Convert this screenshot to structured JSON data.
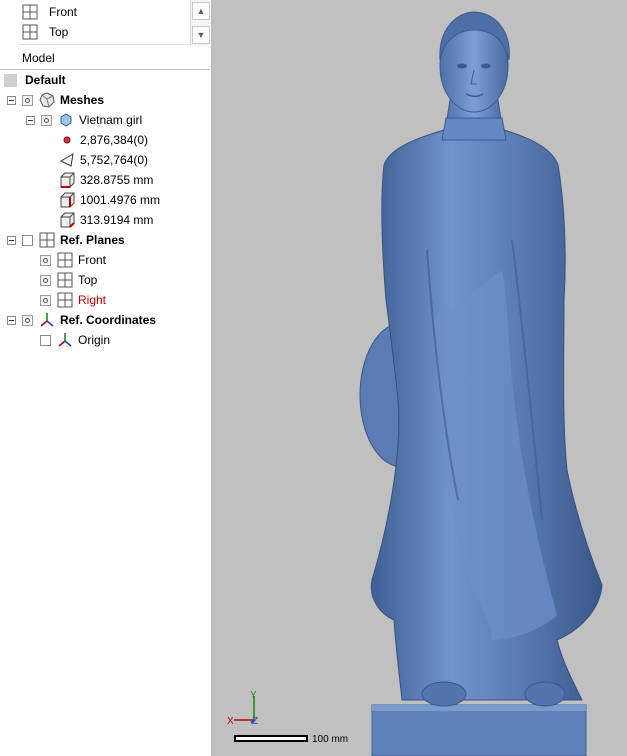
{
  "views": {
    "items": [
      {
        "label": "Front"
      },
      {
        "label": "Top"
      }
    ]
  },
  "model_section": {
    "label": "Model"
  },
  "tree": {
    "root": {
      "label": "Default"
    },
    "meshes": {
      "label": "Meshes",
      "item": {
        "label": "Vietnam girl",
        "vertices": "2,876,384(0)",
        "triangles": "5,752,764(0)",
        "size_x": "328.8755 mm",
        "size_y": "1001.4976 mm",
        "size_z": "313.9194 mm"
      }
    },
    "ref_planes": {
      "label": "Ref. Planes",
      "items": [
        {
          "label": "Front"
        },
        {
          "label": "Top"
        },
        {
          "label": "Right"
        }
      ]
    },
    "ref_coordinates": {
      "label": "Ref. Coordinates",
      "items": [
        {
          "label": "Origin"
        }
      ]
    }
  },
  "viewport": {
    "scale_label": "100 mm",
    "axes": {
      "x": "X",
      "y": "Y",
      "z": "Z"
    },
    "colors": {
      "background": "#c0c0c0",
      "mesh": "#5d7fb8",
      "highlight_red": "#c00000"
    }
  }
}
